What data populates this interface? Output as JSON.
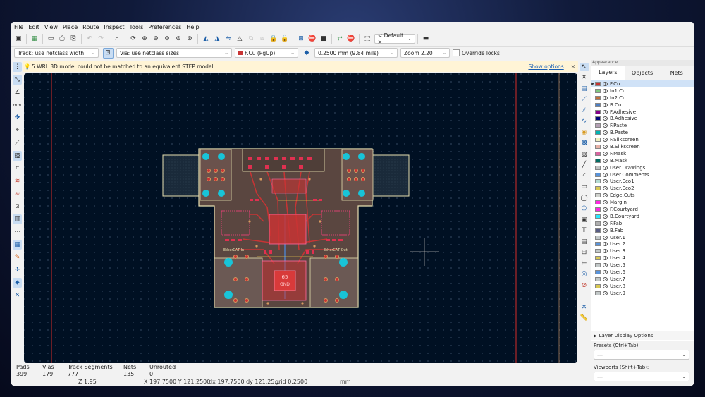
{
  "menu": [
    "File",
    "Edit",
    "View",
    "Place",
    "Route",
    "Inspect",
    "Tools",
    "Preferences",
    "Help"
  ],
  "toolbar": {
    "viewport_preset": "< Default >"
  },
  "toolbar2": {
    "track_width": "Track: use netclass width",
    "via_size": "Via: use netclass sizes",
    "layer": "F.Cu (PgUp)",
    "layer_color": "#c83434",
    "grid": "0.2500 mm (9.84 mils)",
    "zoom": "Zoom 2.20",
    "override_locks": "Override locks"
  },
  "infobar": {
    "message": "5 WRL 3D model could not be matched to an equivalent STEP model.",
    "show_options": "Show options"
  },
  "board": {
    "label_left": "EtherCAT In",
    "label_right": "EtherCAT Out",
    "chip_label_1": "65",
    "chip_label_2": "GND"
  },
  "appearance": {
    "title": "Appearance",
    "tabs": [
      "Layers",
      "Objects",
      "Nets"
    ],
    "layers": [
      {
        "name": "F.Cu",
        "color": "#c83434"
      },
      {
        "name": "In1.Cu",
        "color": "#7fc87f"
      },
      {
        "name": "In2.Cu",
        "color": "#c2703a"
      },
      {
        "name": "B.Cu",
        "color": "#4d7fc4"
      },
      {
        "name": "F.Adhesive",
        "color": "#84008a"
      },
      {
        "name": "B.Adhesive",
        "color": "#00057a"
      },
      {
        "name": "F.Paste",
        "color": "#b4a0b4"
      },
      {
        "name": "B.Paste",
        "color": "#00b4b4"
      },
      {
        "name": "F.Silkscreen",
        "color": "#f0f0c0"
      },
      {
        "name": "B.Silkscreen",
        "color": "#e8b2a7"
      },
      {
        "name": "F.Mask",
        "color": "#d864a0"
      },
      {
        "name": "B.Mask",
        "color": "#026d63"
      },
      {
        "name": "User.Drawings",
        "color": "#c2c2c2"
      },
      {
        "name": "User.Comments",
        "color": "#5994dc"
      },
      {
        "name": "User.Eco1",
        "color": "#b4dbd2"
      },
      {
        "name": "User.Eco2",
        "color": "#d8c852"
      },
      {
        "name": "Edge.Cuts",
        "color": "#d0d2cd"
      },
      {
        "name": "Margin",
        "color": "#ff26e2"
      },
      {
        "name": "F.Courtyard",
        "color": "#ff26e2"
      },
      {
        "name": "B.Courtyard",
        "color": "#26e9ff"
      },
      {
        "name": "F.Fab",
        "color": "#afafaf"
      },
      {
        "name": "B.Fab",
        "color": "#585d84"
      },
      {
        "name": "User.1",
        "color": "#c2c8c8"
      },
      {
        "name": "User.2",
        "color": "#5994dc"
      },
      {
        "name": "User.3",
        "color": "#c2c8c8"
      },
      {
        "name": "User.4",
        "color": "#d8c852"
      },
      {
        "name": "User.5",
        "color": "#c2c8c8"
      },
      {
        "name": "User.6",
        "color": "#5994dc"
      },
      {
        "name": "User.7",
        "color": "#c2c8c8"
      },
      {
        "name": "User.8",
        "color": "#d8c852"
      },
      {
        "name": "User.9",
        "color": "#c2c8c8"
      }
    ],
    "layer_display_options": "Layer Display Options",
    "presets_label": "Presets (Ctrl+Tab):",
    "presets_value": "---",
    "viewports_label": "Viewports (Shift+Tab):",
    "viewports_value": "---"
  },
  "status": {
    "pads_label": "Pads",
    "pads_value": "399",
    "vias_label": "Vias",
    "vias_value": "179",
    "tracks_label": "Track Segments",
    "tracks_value": "777",
    "nets_label": "Nets",
    "nets_value": "135",
    "unrouted_label": "Unrouted",
    "unrouted_value": "0",
    "zoom": "Z 1.95",
    "xy": "X 197.7500  Y 121.2500",
    "dxy": "dx 197.7500  dy 121.25...",
    "grid": "grid 0.2500",
    "units": "mm"
  }
}
